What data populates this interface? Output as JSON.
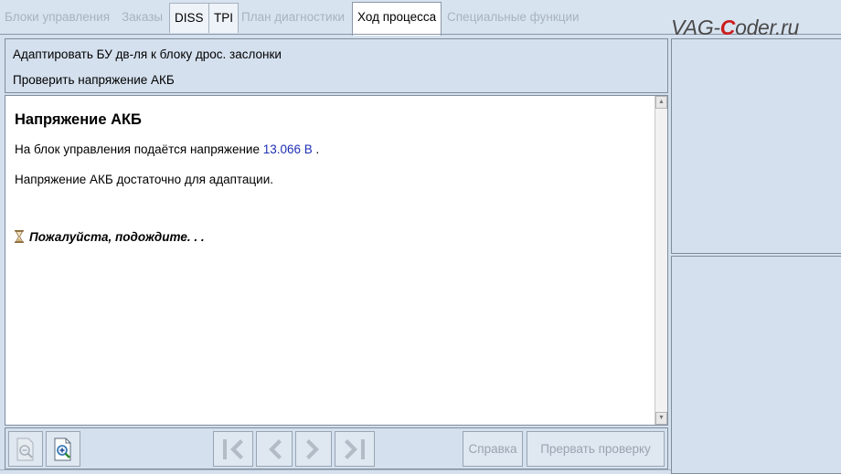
{
  "tabs": [
    {
      "label": "Блоки управления",
      "state": "disabled"
    },
    {
      "label": "Заказы",
      "state": "disabled"
    },
    {
      "label": "DISS",
      "state": "enabled"
    },
    {
      "label": "TPI",
      "state": "enabled"
    },
    {
      "label": "План диагностики",
      "state": "disabled"
    },
    {
      "label": "Ход процесса",
      "state": "active"
    },
    {
      "label": "Специальные функции",
      "state": "disabled"
    }
  ],
  "watermark": {
    "prefix": "VAG-",
    "accent": "C",
    "suffix": "oder.ru"
  },
  "steps": [
    "Адаптировать БУ дв-ля к блоку дрос. заслонки",
    "Проверить напряжение АКБ"
  ],
  "content": {
    "heading": "Напряжение АКБ",
    "line1_prefix": "На блок управления подаётся напряжение ",
    "voltage": "13.066 В",
    "line1_suffix": " .",
    "line2": "Напряжение АКБ достаточно для адаптации.",
    "wait": "Пожалуйста, подождите. . ."
  },
  "toolbar": {
    "help_label": "Справка",
    "abort_label": "Прервать проверку"
  },
  "icons": {
    "zoom_out": "zoom-out-icon",
    "zoom_in": "zoom-in-icon",
    "first": "skip-first-icon",
    "prev": "chevron-left-icon",
    "next": "chevron-right-icon",
    "last": "skip-last-icon",
    "wait": "hourglass-icon"
  },
  "colors": {
    "voltage": "#1f2fb4",
    "watermark_accent": "#cc1d1d",
    "disabled_text": "#a9b3be"
  }
}
